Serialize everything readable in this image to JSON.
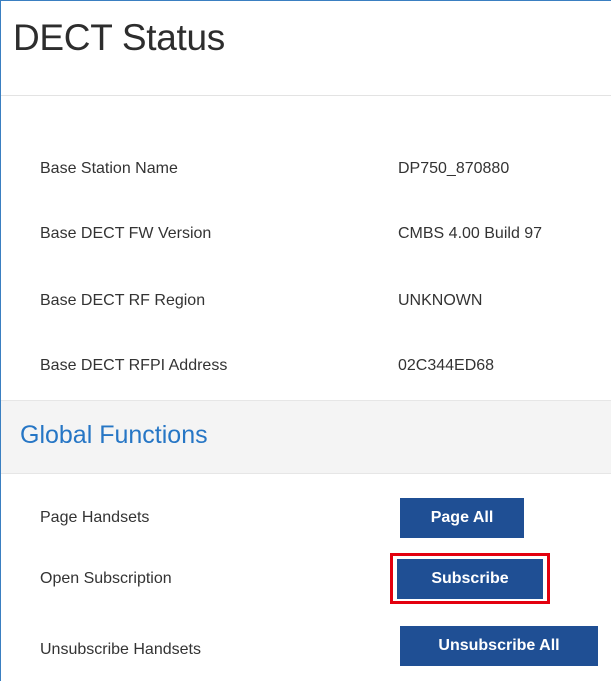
{
  "header": {
    "title": "DECT Status"
  },
  "status_rows": [
    {
      "label": "Base Station Name",
      "value": "DP750_870880"
    },
    {
      "label": "Base DECT FW Version",
      "value": "CMBS 4.00 Build 97"
    },
    {
      "label": "Base DECT RF Region",
      "value": "UNKNOWN"
    },
    {
      "label": "Base DECT RFPI Address",
      "value": "02C344ED68"
    }
  ],
  "global_functions": {
    "title": "Global Functions",
    "rows": [
      {
        "label": "Page Handsets",
        "button": "Page All"
      },
      {
        "label": "Open Subscription",
        "button": "Subscribe"
      },
      {
        "label": "Unsubscribe Handsets",
        "button": "Unsubscribe All"
      }
    ]
  },
  "colors": {
    "frame_border": "#3a7fc1",
    "section_title": "#2676c5",
    "button_bg": "#1f4f94",
    "highlight": "#e3000f"
  }
}
